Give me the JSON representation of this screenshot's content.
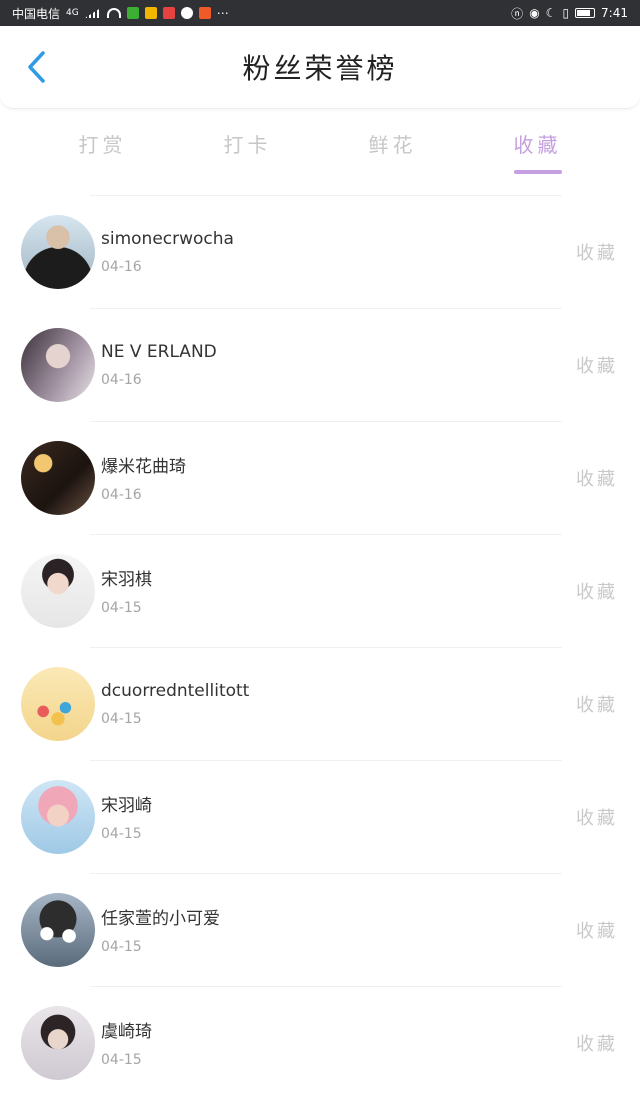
{
  "status_bar": {
    "carrier": "中国电信",
    "network": "4G",
    "time": "7:41"
  },
  "header": {
    "title": "粉丝荣誉榜"
  },
  "tabs": [
    {
      "label": "打赏",
      "active": false
    },
    {
      "label": "打卡",
      "active": false
    },
    {
      "label": "鲜花",
      "active": false
    },
    {
      "label": "收藏",
      "active": true
    }
  ],
  "colors": {
    "accent": "#c69fe0",
    "back": "#2f9be6",
    "inactive": "#c7c7c7"
  },
  "fans": [
    {
      "name": "simonecrwocha",
      "date": "04-16",
      "action": "收藏"
    },
    {
      "name": "NE V ERLAND",
      "date": "04-16",
      "action": "收藏"
    },
    {
      "name": "爆米花曲琦",
      "date": "04-16",
      "action": "收藏"
    },
    {
      "name": "宋羽棋",
      "date": "04-15",
      "action": "收藏"
    },
    {
      "name": "dcuorredntellitott",
      "date": "04-15",
      "action": "收藏"
    },
    {
      "name": "宋羽崎",
      "date": "04-15",
      "action": "收藏"
    },
    {
      "name": "任家萱的小可爱",
      "date": "04-15",
      "action": "收藏"
    },
    {
      "name": "虞崎琦",
      "date": "04-15",
      "action": "收藏"
    }
  ]
}
